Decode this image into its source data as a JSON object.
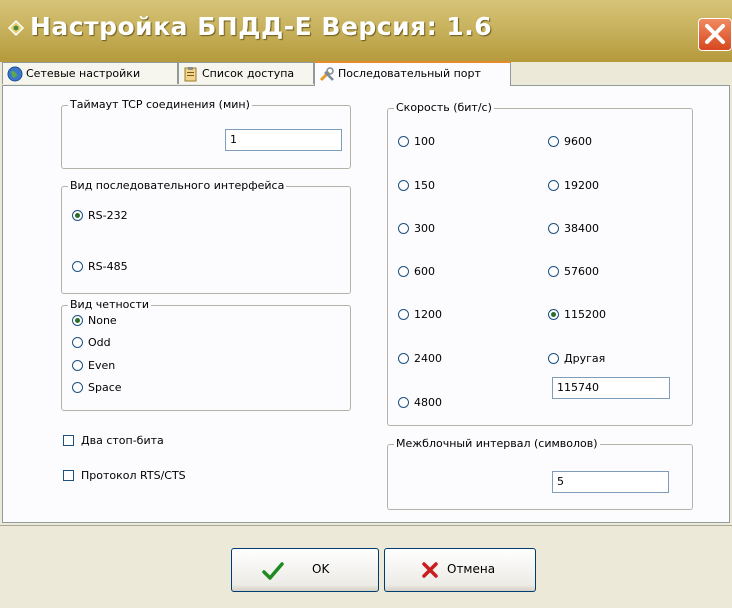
{
  "window": {
    "title": "Настройка БПДД-Е   Версия: 1.6"
  },
  "tabs": [
    {
      "label": "Сетевые настройки",
      "icon": "globe-icon"
    },
    {
      "label": "Список доступа",
      "icon": "clipboard-icon"
    },
    {
      "label": "Последовательный порт",
      "icon": "tools-icon",
      "active": true
    }
  ],
  "tcp_timeout": {
    "legend": "Таймаут TCP соединения (мин)",
    "value": "1"
  },
  "interface": {
    "legend": "Вид последовательного интерфейса",
    "options": [
      "RS-232",
      "RS-485"
    ],
    "selected": "RS-232"
  },
  "parity": {
    "legend": "Вид четности",
    "options": [
      "None",
      "Odd",
      "Even",
      "Space"
    ],
    "selected": "None"
  },
  "checks": {
    "two_stop_bits": "Два стоп-бита",
    "rts_cts": "Протокол RTS/CTS"
  },
  "speed": {
    "legend": "Скорость (бит/с)",
    "left": [
      "100",
      "150",
      "300",
      "600",
      "1200",
      "2400",
      "4800"
    ],
    "right": [
      "9600",
      "19200",
      "38400",
      "57600",
      "115200",
      "Другая"
    ],
    "selected": "115200",
    "custom_value": "115740"
  },
  "interblock": {
    "legend": "Межблочный интервал (символов)",
    "value": "5"
  },
  "buttons": {
    "ok": "OK",
    "cancel": "Отмена"
  },
  "colors": {
    "title_bar": "#c8b25e",
    "tab_accent": "#e68b2c",
    "close": "#d7471f"
  }
}
